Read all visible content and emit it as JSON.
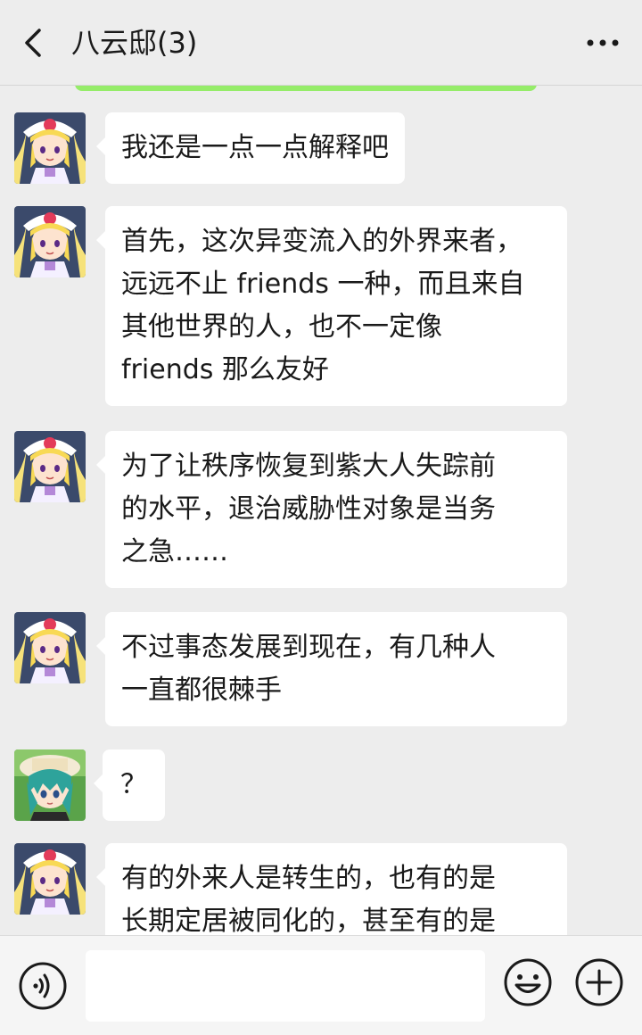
{
  "header": {
    "title": "八云邸(3)",
    "back_icon": "chevron-left-icon",
    "more_icon": "more-horizontal-icon"
  },
  "colors": {
    "background": "#ededed",
    "bubble": "#ffffff",
    "accent_green": "#95ec69"
  },
  "messages": [
    {
      "sender": "yukari",
      "lines": [
        "我还是一点一点解释吧"
      ]
    },
    {
      "sender": "yukari",
      "lines": [
        "首先，这次异变流入的外界来者，",
        "远远不止 friends 一种，而且来自",
        "其他世界的人，也不一定像",
        "friends 那么友好"
      ]
    },
    {
      "sender": "yukari",
      "lines": [
        "为了让秩序恢复到紫大人失踪前",
        "的水平，退治威胁性对象是当务",
        "之急……"
      ]
    },
    {
      "sender": "yukari",
      "lines": [
        "不过事态发展到现在，有几种人",
        "一直都很棘手"
      ]
    },
    {
      "sender": "green-hair",
      "lines": [
        "？"
      ]
    },
    {
      "sender": "yukari",
      "lines": [
        "有的外来人是转生的，也有的是",
        "长期定居被同化的，甚至有的是"
      ]
    }
  ],
  "input_bar": {
    "voice_icon": "voice-icon",
    "input_value": "",
    "emoji_icon": "emoji-icon",
    "plus_icon": "plus-icon"
  }
}
